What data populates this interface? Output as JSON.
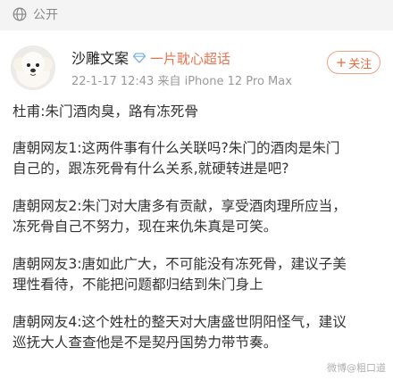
{
  "header": {
    "visibility_label": "公开",
    "visibility_icon": "globe-icon"
  },
  "post": {
    "author": {
      "name": "沙雕文案",
      "avatar_icon": "dog-avatar"
    },
    "group": {
      "name": "一片耽心超话",
      "icon": "diamond-icon"
    },
    "meta": "22-1-17 12:43  来自 iPhone 12 Pro Max",
    "follow_label": "关注",
    "paragraphs": [
      "杜甫:朱门酒肉臭，路有冻死骨",
      "唐朝网友1:这两件事有什么关联吗?朱门的酒肉是朱门\n自己的，跟冻死骨有什么关系,就硬转进是吧?",
      "唐朝网友2:朱门对大唐多有贡献，享受酒肉理所应当，\n冻死骨自己不努力，现在来仇朱真是可笑。",
      "唐朝网友3:唐如此广大，不可能没有冻死骨，建议子美\n理性看待，不能把问题都归结到朱门身上",
      "唐朝网友4:这个姓杜的整天对大唐盛世阴阳怪气，建议\n巡抚大人查查他是不是契丹国势力带节奏。"
    ]
  },
  "watermark": "微博@粗口道",
  "colors": {
    "accent": "#eb7350",
    "follow_border": "#f0a287",
    "topbar_bg": "#f4f4f4"
  }
}
